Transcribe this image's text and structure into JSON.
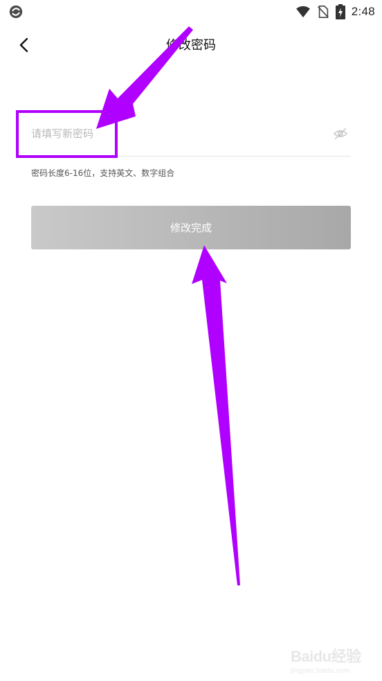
{
  "status_bar": {
    "time": "2:48",
    "icons": [
      "app-notification-icon",
      "wifi-icon",
      "no-sim-icon",
      "battery-charging-icon"
    ]
  },
  "header": {
    "title": "修改密码",
    "back_icon": "chevron-left-icon"
  },
  "form": {
    "password_placeholder": "请填写新密码",
    "password_value": "",
    "visibility_icon": "eye-off-icon",
    "hint": "密码长度6-16位，支持英文、数字组合",
    "submit_label": "修改完成"
  },
  "annotation": {
    "color": "#b000ff"
  },
  "watermark": {
    "logo": "Baidu经验",
    "url": "jingyan.baidu.com"
  },
  "colors": {
    "button_start": "#c9c9c9",
    "button_end": "#a8a8a8",
    "placeholder": "#b9b9b9"
  }
}
